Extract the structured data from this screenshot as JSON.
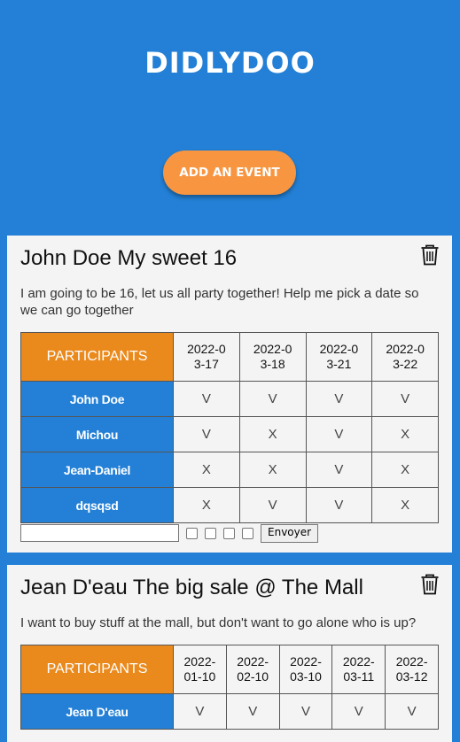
{
  "brand": {
    "logo_text": "DIDLYDOO"
  },
  "header": {
    "add_event_label": "ADD AN EVENT"
  },
  "events": [
    {
      "title": "John Doe My sweet 16",
      "description": "I am going to be 16, let us all party together! Help me pick a date so we can go together",
      "participants_header": "PARTICIPANTS",
      "dates": [
        "2022-03-17",
        "2022-03-18",
        "2022-03-21",
        "2022-03-22"
      ],
      "rows": [
        {
          "name": "John Doe",
          "votes": [
            "V",
            "V",
            "V",
            "V"
          ]
        },
        {
          "name": "Michou",
          "votes": [
            "V",
            "X",
            "V",
            "X"
          ]
        },
        {
          "name": "Jean-Daniel",
          "votes": [
            "X",
            "X",
            "V",
            "X"
          ]
        },
        {
          "name": "dqsqsd",
          "votes": [
            "X",
            "V",
            "V",
            "X"
          ]
        }
      ],
      "name_input_value": "",
      "send_label": "Envoyer"
    },
    {
      "title": "Jean D'eau The big sale @ The Mall",
      "description": "I want to buy stuff at the mall, but don't want to go alone who is up?",
      "participants_header": "PARTICIPANTS",
      "dates": [
        "2022-01-10",
        "2022-02-10",
        "2022-03-10",
        "2022-03-11",
        "2022-03-12"
      ],
      "rows": [
        {
          "name": "Jean D'eau",
          "votes": [
            "V",
            "V",
            "V",
            "V",
            "V"
          ]
        }
      ]
    }
  ],
  "icons": {
    "delete": "trash-icon"
  },
  "colors": {
    "background": "#2380d6",
    "accent": "#f89540",
    "participants_header": "#ea8a1d",
    "name_cell": "#2380d6",
    "card": "#f4f4f4"
  }
}
